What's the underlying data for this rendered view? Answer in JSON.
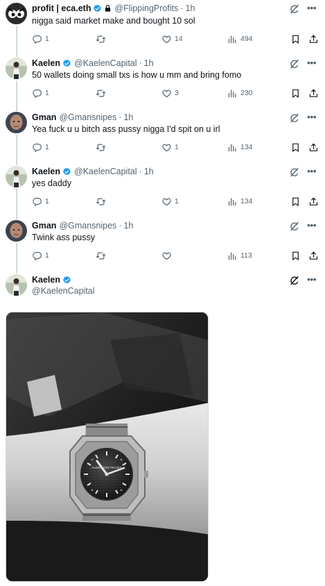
{
  "tweets": [
    {
      "name": "profit | eca.eth",
      "handle": "@FlippingProfits",
      "time": "1h",
      "text": "nigga said market make and bought 10 sol",
      "replies": "1",
      "retweets": "",
      "likes": "14",
      "views": "494",
      "verified": true,
      "locked": true
    },
    {
      "name": "Kaelen",
      "handle": "@KaelenCapital",
      "time": "1h",
      "text": "50 wallets doing small txs is how u mm and bring fomo",
      "replies": "1",
      "retweets": "",
      "likes": "3",
      "views": "230",
      "verified": true
    },
    {
      "name": "Gman",
      "handle": "@Gmansnipes",
      "time": "1h",
      "text": "Yea fuck u u bitch ass pussy nigga I'd spit on u irl",
      "replies": "1",
      "retweets": "",
      "likes": "1",
      "views": "134",
      "verified": false
    },
    {
      "name": "Kaelen",
      "handle": "@KaelenCapital",
      "time": "1h",
      "text": "yes daddy",
      "replies": "1",
      "retweets": "",
      "likes": "1",
      "views": "134",
      "verified": true
    },
    {
      "name": "Gman",
      "handle": "@Gmansnipes",
      "time": "1h",
      "text": "Twink ass pussy",
      "replies": "1",
      "retweets": "",
      "likes": "",
      "views": "113",
      "verified": false
    }
  ],
  "focused_tweet": {
    "name": "Kaelen",
    "handle": "@KaelenCapital",
    "verified": true,
    "media_watch_brand": "AUDEMARS PIGUET"
  },
  "separator": "·",
  "icons": {
    "reply": "reply-icon",
    "retweet": "retweet-icon",
    "like": "heart-icon",
    "views": "views-icon",
    "bookmark": "bookmark-icon",
    "share": "share-icon",
    "grok": "grok-icon",
    "more": "more-icon",
    "verified": "verified-badge-icon",
    "lock": "lock-icon"
  },
  "colors": {
    "verified": "#1d9bf0",
    "secondary_text": "#536471",
    "primary_text": "#0f1419"
  }
}
